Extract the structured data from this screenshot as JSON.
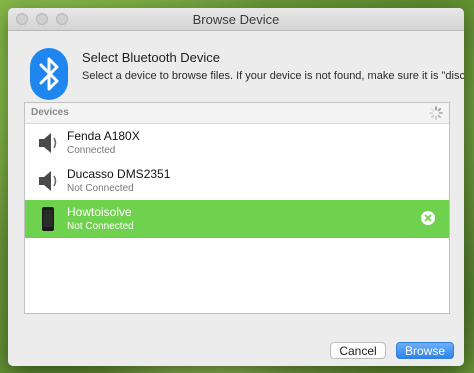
{
  "window": {
    "title": "Browse Device"
  },
  "header": {
    "title": "Select Bluetooth Device",
    "description": "Select a device to browse files. If your device is not found, make sure it is \"discoverable\""
  },
  "list": {
    "header_label": "Devices",
    "devices": [
      {
        "name": "Fenda A180X",
        "status": "Connected",
        "icon": "speaker-icon"
      },
      {
        "name": "Ducasso DMS2351",
        "status": "Not Connected",
        "icon": "speaker-icon"
      },
      {
        "name": "Howtoisolve",
        "status": "Not Connected",
        "icon": "phone-icon",
        "selected": true
      }
    ]
  },
  "buttons": {
    "cancel_label": "Cancel",
    "browse_label": "Browse"
  },
  "colors": {
    "selection": "#6fd24e",
    "primary_button": "#2f84ee",
    "bluetooth": "#1f86f0"
  }
}
